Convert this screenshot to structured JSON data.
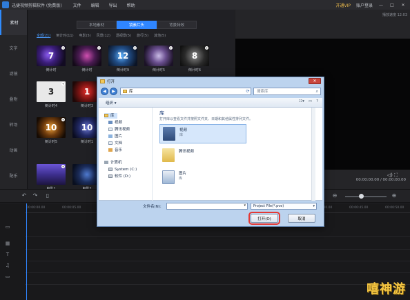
{
  "titlebar": {
    "app_title": "迅捷视频剪辑软件 (免费版)",
    "menu": [
      "文件",
      "编辑",
      "导出",
      "帮助"
    ],
    "vip": "开通VIP",
    "account": "账户登录",
    "controls": [
      "—",
      "□",
      "✕"
    ]
  },
  "leftnav": [
    "素材",
    "文字",
    "滤镜",
    "叠附",
    "转场",
    "动画",
    "配乐"
  ],
  "library": {
    "tabs": [
      "本地素材",
      "镜素片头",
      "背景特效"
    ],
    "categories": [
      "全部(21)",
      "倒计时(11)",
      "电影(5)",
      "风景(12)",
      "透视景(5)",
      "旅行(5)",
      "其他(5)"
    ],
    "thumbs": [
      {
        "label": "倒计时",
        "glyph": "7"
      },
      {
        "label": "倒计时",
        "glyph": ""
      },
      {
        "label": "倒计时9",
        "glyph": "12"
      },
      {
        "label": "倒计时5",
        "glyph": ""
      },
      {
        "label": "倒计时6",
        "glyph": "8"
      },
      {
        "label": "倒计时4",
        "glyph": "3"
      },
      {
        "label": "倒计时3",
        "glyph": "1"
      },
      {
        "label": "倒计时5",
        "glyph": "10"
      },
      {
        "label": "倒计时1",
        "glyph": "10"
      },
      {
        "label": "电影1",
        "glyph": ""
      },
      {
        "label": "电影2",
        "glyph": ""
      }
    ]
  },
  "preview": {
    "top_time": "播放速度 12:03",
    "time": "00:00:00.00 / 00:00:00.00"
  },
  "timeline": {
    "ticks": [
      "00:00:00.00",
      "00:00:05.00",
      "00:00:10.00",
      "00:00:15.00",
      "00:00:20.00",
      "00:00:25.00",
      "00:00:30.00",
      "00:00:35.00",
      "00:00:40.00",
      "00:00:45.00",
      "00:00:50.00"
    ]
  },
  "dialog": {
    "title": "打开",
    "address": "库",
    "search_placeholder": "搜索库",
    "organize": "组织",
    "nav": [
      "库",
      "视频",
      "腾讯视频",
      "图片",
      "文档",
      "音乐",
      "计算机",
      "System (C:)",
      "软件 (D:)"
    ],
    "heading": "库",
    "subheading": "打开库以查看文件并按照文件夹、日期和其他属性排列文件。",
    "items": [
      {
        "name": "视频",
        "kind": "库"
      },
      {
        "name": "腾讯视频",
        "kind": ""
      },
      {
        "name": "图片",
        "kind": "库"
      }
    ],
    "filename_label": "文件名(N):",
    "filename_value": "",
    "filter": "Project File(*.pve)",
    "open_label": "打开(O)",
    "cancel_label": "取消"
  },
  "watermark": "嘻神游"
}
